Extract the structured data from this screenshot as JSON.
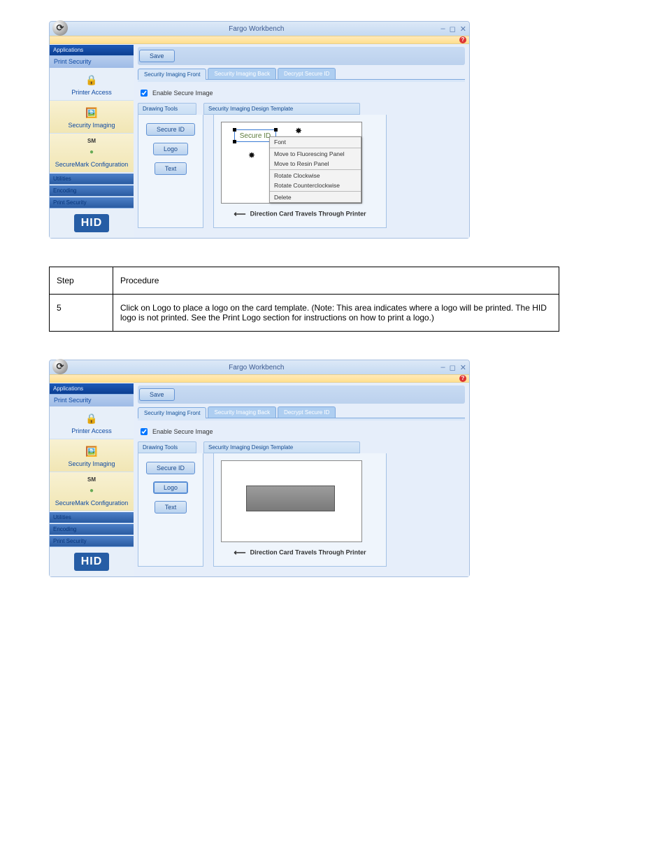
{
  "window": {
    "title": "Fargo Workbench",
    "min_icon": "–",
    "max_icon": "◻",
    "close_icon": "✕"
  },
  "sidebar": {
    "applications": "Applications",
    "print_security": "Print Security",
    "items": {
      "printer_access": "Printer Access",
      "security_imaging": "Security Imaging",
      "securemark_label": "SM",
      "securemark_config": "SecureMark Configuration"
    },
    "utilities": "Utilities",
    "encoding": "Encoding",
    "print_security2": "Print Security",
    "hid": "HID"
  },
  "content": {
    "save": "Save",
    "tabs": {
      "front": "Security Imaging Front",
      "back": "Security Imaging Back",
      "decrypt": "Decrypt Secure ID"
    },
    "enable": "Enable Secure Image",
    "drawing_tools": "Drawing Tools",
    "template_h": "Security Imaging Design Template",
    "tools": {
      "secureid": "Secure ID",
      "logo": "Logo",
      "text": "Text"
    },
    "secure_text": "Secure ID",
    "ctx": {
      "font": "Font",
      "move_fluoro": "Move to Fluorescing Panel",
      "move_resin": "Move to Resin Panel",
      "rot_cw": "Rotate Clockwise",
      "rot_ccw": "Rotate Counterclockwise",
      "delete": "Delete"
    },
    "direction": "Direction Card Travels Through Printer"
  },
  "table": {
    "step": "Step",
    "procedure": "Procedure",
    "num": "5",
    "text": "Click on Logo to place a logo on the card template. (Note: This area indicates where a logo will be printed. The HID logo is not printed. See the Print Logo section for instructions on how to print a logo.)"
  }
}
